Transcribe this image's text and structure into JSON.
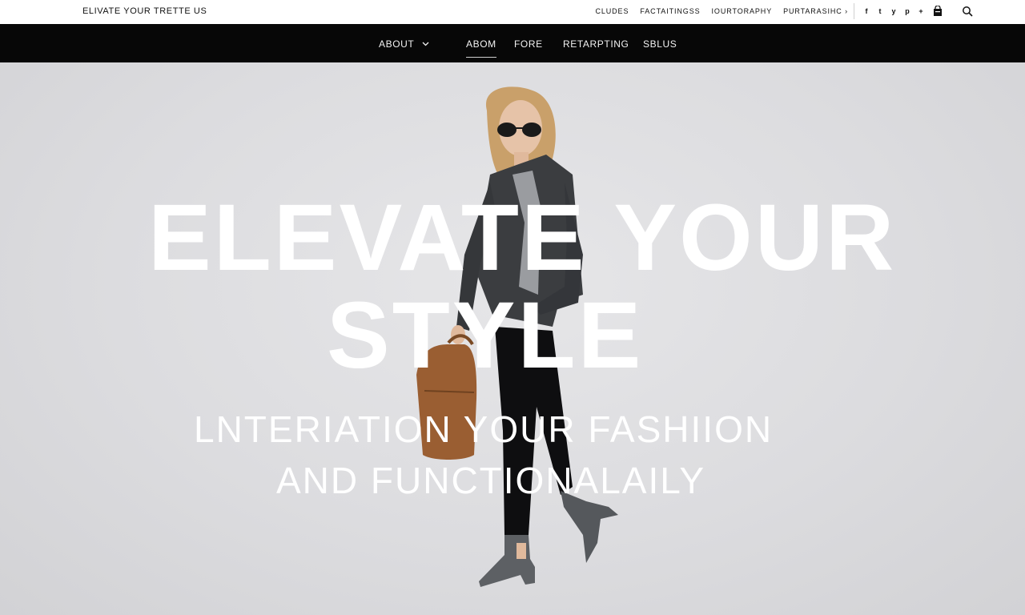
{
  "header": {
    "brand": "ELIVATE YOUR TRETTE US",
    "util_links": [
      "CLUDES",
      "FACTAITINGSS",
      "IOURTORAPHY",
      "PURTARASIHC"
    ],
    "util_trail": "›",
    "social_icons": [
      "f",
      "t",
      "y",
      "p",
      "+"
    ],
    "bag_icon": "bag-icon",
    "search_icon": "search-icon"
  },
  "nav": {
    "items": [
      "ABOUT",
      "ABOM",
      "FORE",
      "RETARPTING",
      "SBLUS"
    ],
    "active_item": "ABOM"
  },
  "hero": {
    "headline_line1": "ELEVATE YOUR",
    "headline_line2": "STYLE",
    "sub_line1": "LNTERIATION YOUR FASHIION",
    "sub_line2": "AND FUNCTIONALAILY"
  },
  "colors": {
    "topbar_bg": "#ffffff",
    "navbar_bg": "#070707",
    "hero_bg": "#dedee0",
    "headline_text": "#ffffff"
  }
}
